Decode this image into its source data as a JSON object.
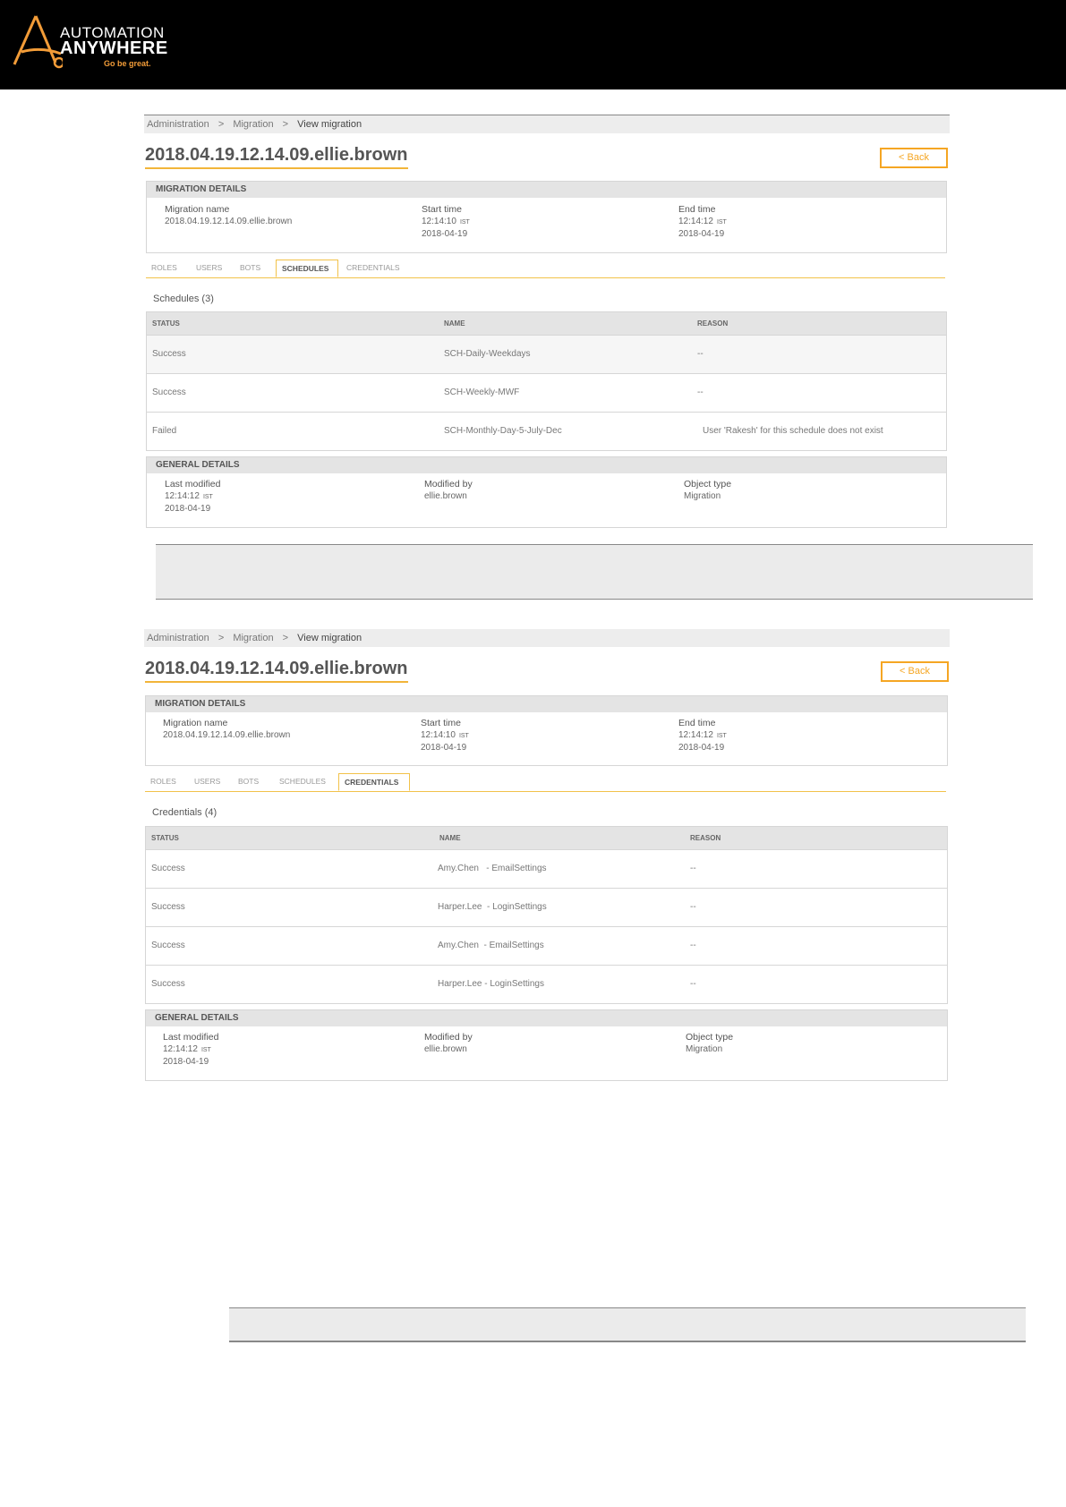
{
  "brand": {
    "line1": "AUTOMATION",
    "line2": "ANYWHERE",
    "tagline": "Go be great."
  },
  "screens": [
    {
      "breadcrumb": {
        "root": "Administration",
        "mid": "Migration",
        "current": "View migration",
        "sep": ">"
      },
      "title": "2018.04.19.12.14.09.ellie.brown",
      "back_label": "< Back",
      "migration_details": {
        "heading": "MIGRATION DETAILS",
        "name_label": "Migration name",
        "name_value": "2018.04.19.12.14.09.ellie.brown",
        "start_label": "Start time",
        "start_time": "12:14:10",
        "start_tz": "IST",
        "start_date": "2018-04-19",
        "end_label": "End time",
        "end_time": "12:14:12",
        "end_tz": "IST",
        "end_date": "2018-04-19"
      },
      "tabs": [
        "ROLES",
        "USERS",
        "BOTS",
        "SCHEDULES",
        "CREDENTIALS"
      ],
      "active_tab": "SCHEDULES",
      "section_title": "Schedules (3)",
      "columns": [
        "STATUS",
        "NAME",
        "REASON"
      ],
      "rows": [
        {
          "status": "Success",
          "name": "SCH-Daily-Weekdays",
          "reason": "--"
        },
        {
          "status": "Success",
          "name": "SCH-Weekly-MWF",
          "reason": "--"
        },
        {
          "status": "Failed",
          "name": "SCH-Monthly-Day-5-July-Dec",
          "reason": "User 'Rakesh' for this schedule does not exist"
        }
      ],
      "general_details": {
        "heading": "GENERAL DETAILS",
        "modified_label": "Last modified",
        "modified_time": "12:14:12",
        "modified_tz": "IST",
        "modified_date": "2018-04-19",
        "by_label": "Modified by",
        "by_value": "ellie.brown",
        "type_label": "Object type",
        "type_value": "Migration"
      }
    },
    {
      "breadcrumb": {
        "root": "Administration",
        "mid": "Migration",
        "current": "View migration",
        "sep": ">"
      },
      "title": "2018.04.19.12.14.09.ellie.brown",
      "back_label": "< Back",
      "migration_details": {
        "heading": "MIGRATION DETAILS",
        "name_label": "Migration name",
        "name_value": "2018.04.19.12.14.09.ellie.brown",
        "start_label": "Start time",
        "start_time": "12:14:10",
        "start_tz": "IST",
        "start_date": "2018-04-19",
        "end_label": "End time",
        "end_time": "12:14:12",
        "end_tz": "IST",
        "end_date": "2018-04-19"
      },
      "tabs": [
        "ROLES",
        "USERS",
        "BOTS",
        "SCHEDULES",
        "CREDENTIALS"
      ],
      "active_tab": "CREDENTIALS",
      "section_title": "Credentials (4)",
      "columns": [
        "STATUS",
        "NAME",
        "REASON"
      ],
      "rows": [
        {
          "status": "Success",
          "name": "Amy.Chen   - EmailSettings",
          "reason": "--"
        },
        {
          "status": "Success",
          "name": "Harper.Lee  - LoginSettings",
          "reason": "--"
        },
        {
          "status": "Success",
          "name": "Amy.Chen  - EmailSettings",
          "reason": "--"
        },
        {
          "status": "Success",
          "name": "Harper.Lee - LoginSettings",
          "reason": "--"
        }
      ],
      "general_details": {
        "heading": "GENERAL DETAILS",
        "modified_label": "Last modified",
        "modified_time": "12:14:12",
        "modified_tz": "IST",
        "modified_date": "2018-04-19",
        "by_label": "Modified by",
        "by_value": "ellie.brown",
        "type_label": "Object type",
        "type_value": "Migration"
      }
    }
  ],
  "colors": {
    "accent": "#f5a623",
    "header_bg": "#000000",
    "table_head": "#e4e4e4"
  }
}
